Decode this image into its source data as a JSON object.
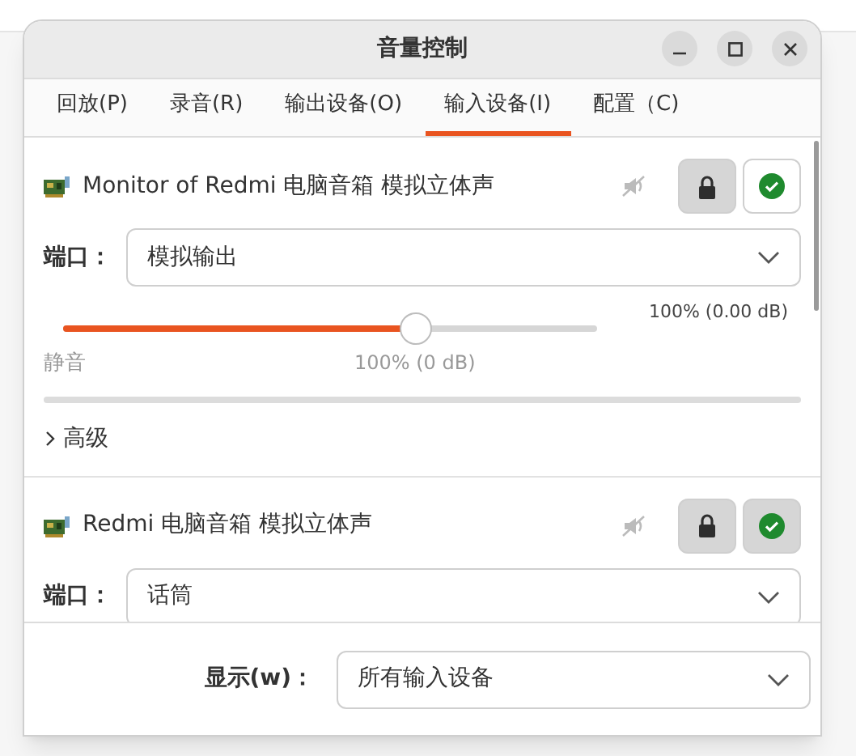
{
  "window": {
    "title": "音量控制"
  },
  "tabs": [
    {
      "label": "回放(P)",
      "selected": false
    },
    {
      "label": "录音(R)",
      "selected": false
    },
    {
      "label": "输出设备(O)",
      "selected": false
    },
    {
      "label": "输入设备(I)",
      "selected": true
    },
    {
      "label": "配置（C)",
      "selected": false
    }
  ],
  "devices": [
    {
      "name": "Monitor of Redmi 电脑音箱 模拟立体声",
      "muted": false,
      "locked": true,
      "default_active": false,
      "port_label": "端口：",
      "port": "模拟输出",
      "volume": {
        "reading": "100% (0.00 dB)",
        "level": 0.66,
        "min_label": "静音",
        "mark_label": "100% (0 dB)"
      },
      "advanced": {
        "label": "高级",
        "expanded": false
      }
    },
    {
      "name": "Redmi 电脑音箱 模拟立体声",
      "muted": false,
      "locked": true,
      "default_active": true,
      "port_label": "端口：",
      "port": "话筒"
    }
  ],
  "footer": {
    "label": "显示(w)：",
    "value": "所有输入设备"
  }
}
